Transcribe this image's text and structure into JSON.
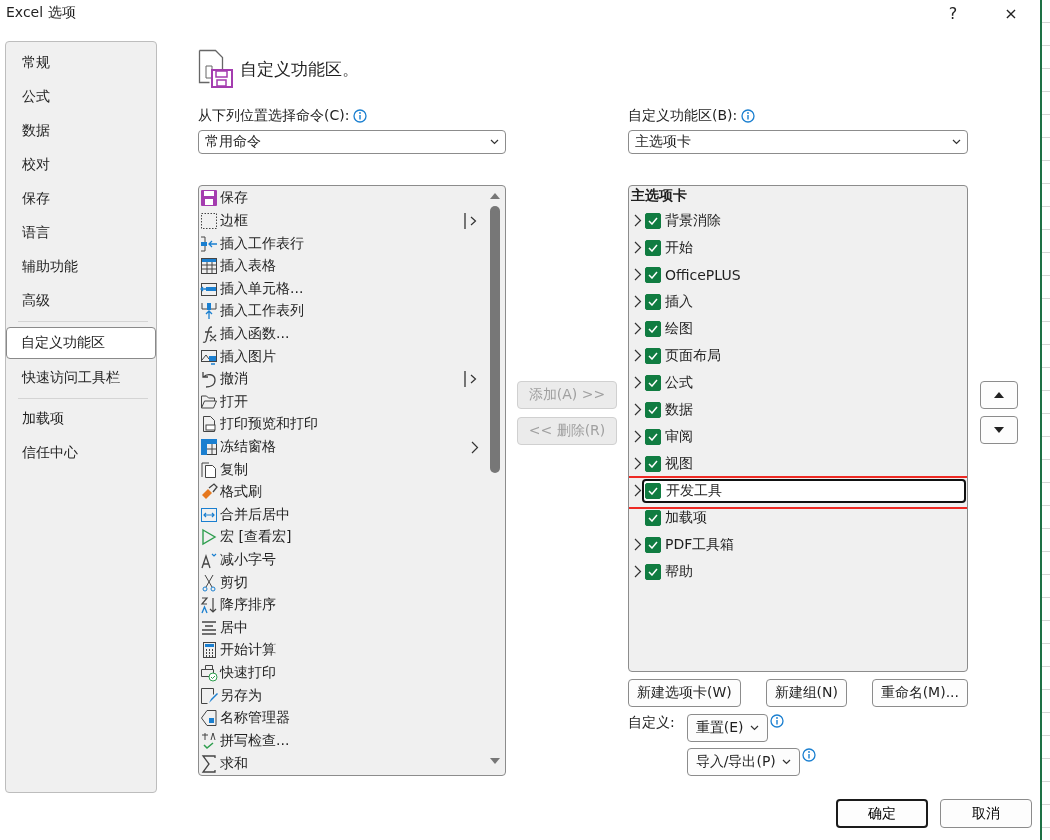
{
  "window": {
    "title": "Excel 选项",
    "help": "?",
    "close": "×"
  },
  "sidebar": {
    "items": [
      {
        "label": "常规",
        "selected": false
      },
      {
        "label": "公式",
        "selected": false
      },
      {
        "label": "数据",
        "selected": false
      },
      {
        "label": "校对",
        "selected": false
      },
      {
        "label": "保存",
        "selected": false
      },
      {
        "label": "语言",
        "selected": false
      },
      {
        "label": "辅助功能",
        "selected": false
      },
      {
        "label": "高级",
        "selected": false,
        "divider_after": true
      },
      {
        "label": "自定义功能区",
        "selected": true
      },
      {
        "label": "快速访问工具栏",
        "selected": false,
        "divider_after": true
      },
      {
        "label": "加载项",
        "selected": false
      },
      {
        "label": "信任中心",
        "selected": false
      }
    ]
  },
  "heading": "自定义功能区。",
  "commands_panel": {
    "label": "从下列位置选择命令(C):",
    "dropdown": {
      "value": "常用命令"
    },
    "items": [
      {
        "label": "保存",
        "kind": "plain"
      },
      {
        "label": "边框",
        "kind": "split"
      },
      {
        "label": "插入工作表行",
        "kind": "plain"
      },
      {
        "label": "插入表格",
        "kind": "plain"
      },
      {
        "label": "插入单元格...",
        "kind": "plain"
      },
      {
        "label": "插入工作表列",
        "kind": "plain"
      },
      {
        "label": "插入函数...",
        "kind": "plain"
      },
      {
        "label": "插入图片",
        "kind": "plain"
      },
      {
        "label": "撤消",
        "kind": "split"
      },
      {
        "label": "打开",
        "kind": "plain"
      },
      {
        "label": "打印预览和打印",
        "kind": "plain"
      },
      {
        "label": "冻结窗格",
        "kind": "submenu"
      },
      {
        "label": "复制",
        "kind": "plain"
      },
      {
        "label": "格式刷",
        "kind": "plain"
      },
      {
        "label": "合并后居中",
        "kind": "plain"
      },
      {
        "label": "宏 [查看宏]",
        "kind": "plain"
      },
      {
        "label": "减小字号",
        "kind": "plain"
      },
      {
        "label": "剪切",
        "kind": "plain"
      },
      {
        "label": "降序排序",
        "kind": "plain"
      },
      {
        "label": "居中",
        "kind": "plain"
      },
      {
        "label": "开始计算",
        "kind": "plain"
      },
      {
        "label": "快速打印",
        "kind": "plain"
      },
      {
        "label": "另存为",
        "kind": "plain"
      },
      {
        "label": "名称管理器",
        "kind": "plain"
      },
      {
        "label": "拼写检查...",
        "kind": "plain"
      },
      {
        "label": "求和",
        "kind": "plain"
      }
    ]
  },
  "transfer_buttons": [
    {
      "label": "添加(A) >>",
      "disabled": true
    },
    {
      "label": "<< 删除(R)",
      "disabled": true
    }
  ],
  "ribbon_panel": {
    "label": "自定义功能区(B):",
    "dropdown": {
      "value": "主选项卡"
    },
    "tree_title": "主选项卡",
    "items": [
      {
        "label": "背景消除",
        "expandable": true,
        "checked": true,
        "selected": false,
        "highlighted": false
      },
      {
        "label": "开始",
        "expandable": true,
        "checked": true,
        "selected": false,
        "highlighted": false
      },
      {
        "label": "OfficePLUS",
        "expandable": true,
        "checked": true,
        "selected": false,
        "highlighted": false
      },
      {
        "label": "插入",
        "expandable": true,
        "checked": true,
        "selected": false,
        "highlighted": false
      },
      {
        "label": "绘图",
        "expandable": true,
        "checked": true,
        "selected": false,
        "highlighted": false
      },
      {
        "label": "页面布局",
        "expandable": true,
        "checked": true,
        "selected": false,
        "highlighted": false
      },
      {
        "label": "公式",
        "expandable": true,
        "checked": true,
        "selected": false,
        "highlighted": false
      },
      {
        "label": "数据",
        "expandable": true,
        "checked": true,
        "selected": false,
        "highlighted": false
      },
      {
        "label": "审阅",
        "expandable": true,
        "checked": true,
        "selected": false,
        "highlighted": false
      },
      {
        "label": "视图",
        "expandable": true,
        "checked": true,
        "selected": false,
        "highlighted": false
      },
      {
        "label": "开发工具",
        "expandable": true,
        "checked": true,
        "selected": true,
        "highlighted": true
      },
      {
        "label": "加载项",
        "expandable": false,
        "checked": true,
        "selected": false,
        "highlighted": false
      },
      {
        "label": "PDF工具箱",
        "expandable": true,
        "checked": true,
        "selected": false,
        "highlighted": false
      },
      {
        "label": "帮助",
        "expandable": true,
        "checked": true,
        "selected": false,
        "highlighted": false
      }
    ],
    "buttons": [
      "新建选项卡(W)",
      "新建组(N)",
      "重命名(M)..."
    ],
    "customize_label": "自定义:",
    "menu_buttons": [
      "重置(E)",
      "导入/导出(P)"
    ]
  },
  "footer": {
    "ok": "确定",
    "cancel": "取消"
  }
}
